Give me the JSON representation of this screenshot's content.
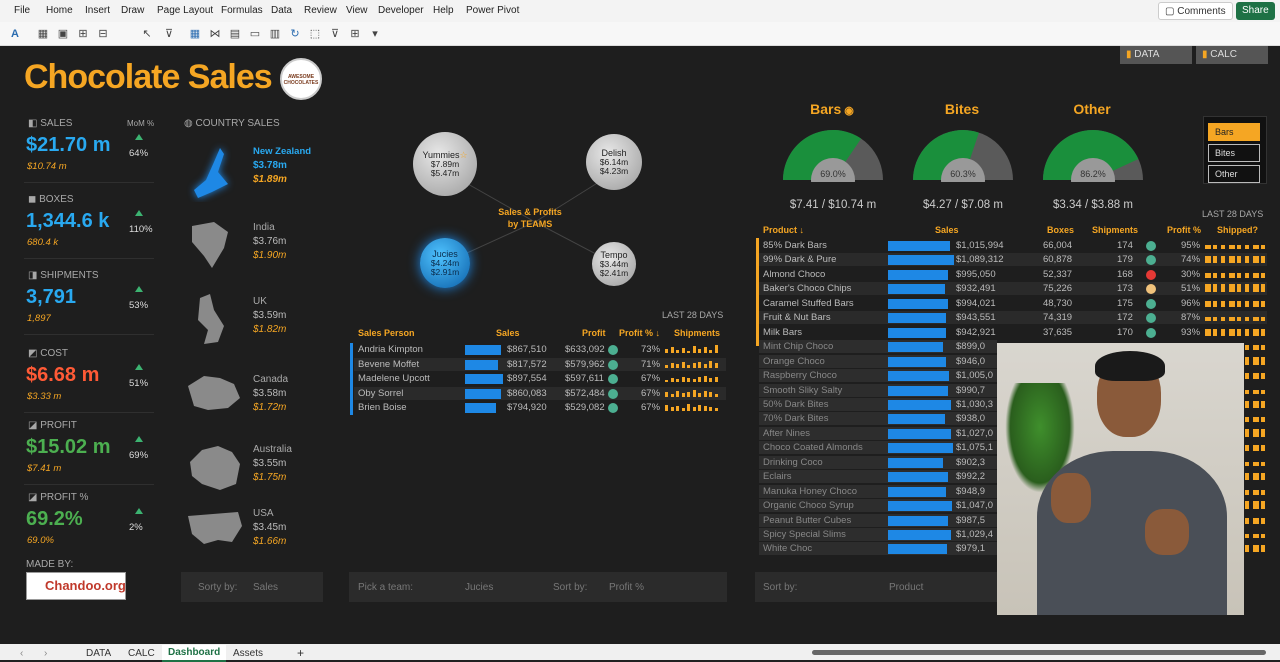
{
  "menu": [
    "File",
    "Home",
    "Insert",
    "Draw",
    "Page Layout",
    "Formulas",
    "Data",
    "Review",
    "View",
    "Developer",
    "Help",
    "Power Pivot"
  ],
  "comments_label": "Comments",
  "share_label": "Share",
  "title": "Chocolate Sales",
  "logo_text": "AWESOME CHOCOLATES",
  "top_buttons": [
    "DATA",
    "CALC"
  ],
  "mom_label": "MoM %",
  "kpis": [
    {
      "label": "SALES",
      "value": "$21.70 m",
      "prev": "$10.74 m",
      "pct": "64%",
      "color": "#29a9f0"
    },
    {
      "label": "BOXES",
      "value": "1,344.6 k",
      "prev": "680.4 k",
      "pct": "110%",
      "color": "#29a9f0"
    },
    {
      "label": "SHIPMENTS",
      "value": "3,791",
      "prev": "1,897",
      "pct": "53%",
      "color": "#29a9f0"
    },
    {
      "label": "COST",
      "value": "$6.68 m",
      "prev": "$3.33 m",
      "pct": "51%",
      "color": "#ff5a36"
    },
    {
      "label": "PROFIT",
      "value": "$15.02 m",
      "prev": "$7.41 m",
      "pct": "69%",
      "color": "#4caf50"
    },
    {
      "label": "PROFIT %",
      "value": "69.2%",
      "prev": "69.0%",
      "pct": "2%",
      "color": "#4caf50"
    }
  ],
  "made_by": "MADE BY:",
  "chandoo": "Chandoo.org",
  "country_label": "COUNTRY SALES",
  "countries": [
    {
      "name": "New Zealand",
      "sales": "$3.78m",
      "profit": "$1.89m"
    },
    {
      "name": "India",
      "sales": "$3.76m",
      "profit": "$1.90m"
    },
    {
      "name": "UK",
      "sales": "$3.59m",
      "profit": "$1.82m"
    },
    {
      "name": "Canada",
      "sales": "$3.58m",
      "profit": "$1.72m"
    },
    {
      "name": "Australia",
      "sales": "$3.55m",
      "profit": "$1.75m"
    },
    {
      "name": "USA",
      "sales": "$3.45m",
      "profit": "$1.66m"
    }
  ],
  "country_sort_label": "Sorty by:",
  "country_sort_value": "Sales",
  "teams_title": "Sales & Profits by TEAMS",
  "teams": [
    {
      "name": "Yummies",
      "sales": "$7.89m",
      "profit": "$5.47m"
    },
    {
      "name": "Delish",
      "sales": "$6.14m",
      "profit": "$4.23m"
    },
    {
      "name": "Jucies",
      "sales": "$4.24m",
      "profit": "$2.91m"
    },
    {
      "name": "Tempo",
      "sales": "$3.44m",
      "profit": "$2.41m"
    }
  ],
  "last28": "LAST 28 DAYS",
  "sp_headers": [
    "Sales Person",
    "Sales",
    "Profit",
    "Profit % ↓",
    "Shipments"
  ],
  "salespeople": [
    {
      "name": "Andria Kimpton",
      "sales": "$867,510",
      "profit": "$633,092",
      "pct": "73%",
      "bar": 0.72
    },
    {
      "name": "Bevene Moffet",
      "sales": "$817,572",
      "profit": "$579,962",
      "pct": "71%",
      "bar": 0.66
    },
    {
      "name": "Madelene Upcott",
      "sales": "$897,554",
      "profit": "$597,611",
      "pct": "67%",
      "bar": 0.76
    },
    {
      "name": "Oby Sorrel",
      "sales": "$860,083",
      "profit": "$572,484",
      "pct": "67%",
      "bar": 0.71
    },
    {
      "name": "Brien Boise",
      "sales": "$794,920",
      "profit": "$529,082",
      "pct": "67%",
      "bar": 0.62
    }
  ],
  "team_filter_label": "Pick a team:",
  "team_filter_value": "Jucies",
  "sp_sort_label": "Sort by:",
  "sp_sort_value": "Profit %",
  "gauges": [
    {
      "title": "Bars",
      "pct": "69.0%",
      "value": "$7.41 / $10.74 m",
      "fraction": 0.69
    },
    {
      "title": "Bites",
      "pct": "60.3%",
      "value": "$4.27 / $7.08 m",
      "fraction": 0.603
    },
    {
      "title": "Other",
      "pct": "86.2%",
      "value": "$3.34 / $3.88 m",
      "fraction": 0.862
    }
  ],
  "slicer": [
    "Bars",
    "Bites",
    "Other"
  ],
  "pr_headers": [
    "Product ↓",
    "Sales",
    "Boxes",
    "Shipments",
    "Profit %",
    "Shipped?"
  ],
  "products": [
    {
      "name": "85% Dark Bars",
      "sales": "$1,015,994",
      "boxes": "66,004",
      "ship": "174",
      "pct": "95%",
      "dot": "#4caf91",
      "bar": 0.72
    },
    {
      "name": "99% Dark & Pure",
      "sales": "$1,089,312",
      "boxes": "60,878",
      "ship": "179",
      "pct": "74%",
      "dot": "#4caf91",
      "bar": 0.77
    },
    {
      "name": "Almond Choco",
      "sales": "$995,050",
      "boxes": "52,337",
      "ship": "168",
      "pct": "30%",
      "dot": "#e53935",
      "bar": 0.7
    },
    {
      "name": "Baker's Choco Chips",
      "sales": "$932,491",
      "boxes": "75,226",
      "ship": "173",
      "pct": "51%",
      "dot": "#f0c27b",
      "bar": 0.66
    },
    {
      "name": "Caramel Stuffed Bars",
      "sales": "$994,021",
      "boxes": "48,730",
      "ship": "175",
      "pct": "96%",
      "dot": "#4caf91",
      "bar": 0.7
    },
    {
      "name": "Fruit & Nut Bars",
      "sales": "$943,551",
      "boxes": "74,319",
      "ship": "172",
      "pct": "87%",
      "dot": "#4caf91",
      "bar": 0.67
    },
    {
      "name": "Milk Bars",
      "sales": "$942,921",
      "boxes": "37,635",
      "ship": "170",
      "pct": "93%",
      "dot": "#4caf91",
      "bar": 0.67
    },
    {
      "name": "Mint Chip Choco",
      "sales": "$899,0",
      "bar": 0.64
    },
    {
      "name": "Orange Choco",
      "sales": "$946,0",
      "bar": 0.67
    },
    {
      "name": "Raspberry Choco",
      "sales": "$1,005,0",
      "bar": 0.71
    },
    {
      "name": "Smooth Sliky Salty",
      "sales": "$990,7",
      "bar": 0.7
    },
    {
      "name": "50% Dark Bites",
      "sales": "$1,030,3",
      "bar": 0.73
    },
    {
      "name": "70% Dark Bites",
      "sales": "$938,0",
      "bar": 0.66
    },
    {
      "name": "After Nines",
      "sales": "$1,027,0",
      "bar": 0.73
    },
    {
      "name": "Choco Coated Almonds",
      "sales": "$1,075,1",
      "bar": 0.76
    },
    {
      "name": "Drinking Coco",
      "sales": "$902,3",
      "bar": 0.64
    },
    {
      "name": "Eclairs",
      "sales": "$992,2",
      "bar": 0.7
    },
    {
      "name": "Manuka Honey Choco",
      "sales": "$948,9",
      "bar": 0.67
    },
    {
      "name": "Organic Choco Syrup",
      "sales": "$1,047,0",
      "bar": 0.74
    },
    {
      "name": "Peanut Butter Cubes",
      "sales": "$987,5",
      "bar": 0.7
    },
    {
      "name": "Spicy Special Slims",
      "sales": "$1,029,4",
      "bar": 0.73
    },
    {
      "name": "White Choc",
      "sales": "$979,1",
      "bar": 0.69
    }
  ],
  "prod_sort_label": "Sort by:",
  "prod_sort_value": "Product",
  "sheet_tabs": [
    "DATA",
    "CALC",
    "Dashboard",
    "Assets"
  ]
}
